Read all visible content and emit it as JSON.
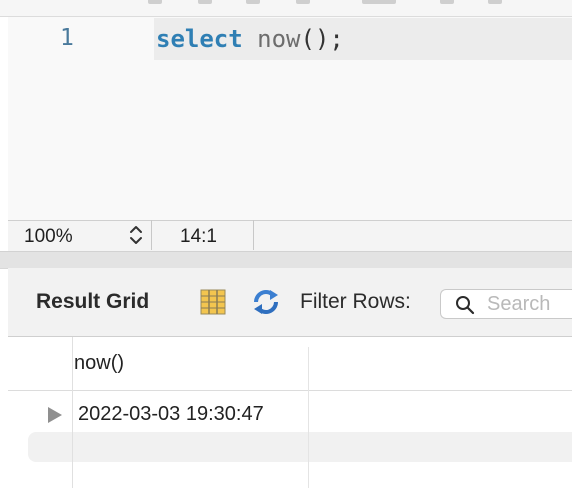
{
  "editor": {
    "line_number": "1",
    "code": {
      "keyword": "select",
      "function": "now",
      "punctuation": "();"
    }
  },
  "statusbar": {
    "zoom": "100%",
    "cursor_position": "14:1"
  },
  "result_toolbar": {
    "title": "Result Grid",
    "filter_label": "Filter Rows:",
    "search_placeholder": "Search",
    "icons": [
      "grid-layout-icon",
      "refresh-icon",
      "search-icon",
      "chevron-updown-icon",
      "row-pointer-icon"
    ]
  },
  "results": {
    "columns": [
      "now()"
    ],
    "rows": [
      [
        "2022-03-03 19:30:47"
      ]
    ]
  },
  "colors": {
    "keyword": "#2f7fb4",
    "line_number": "#4a7a9c",
    "refresh_blue": "#3b7fd1",
    "grid_icon_yellow": "#f3c54f"
  }
}
